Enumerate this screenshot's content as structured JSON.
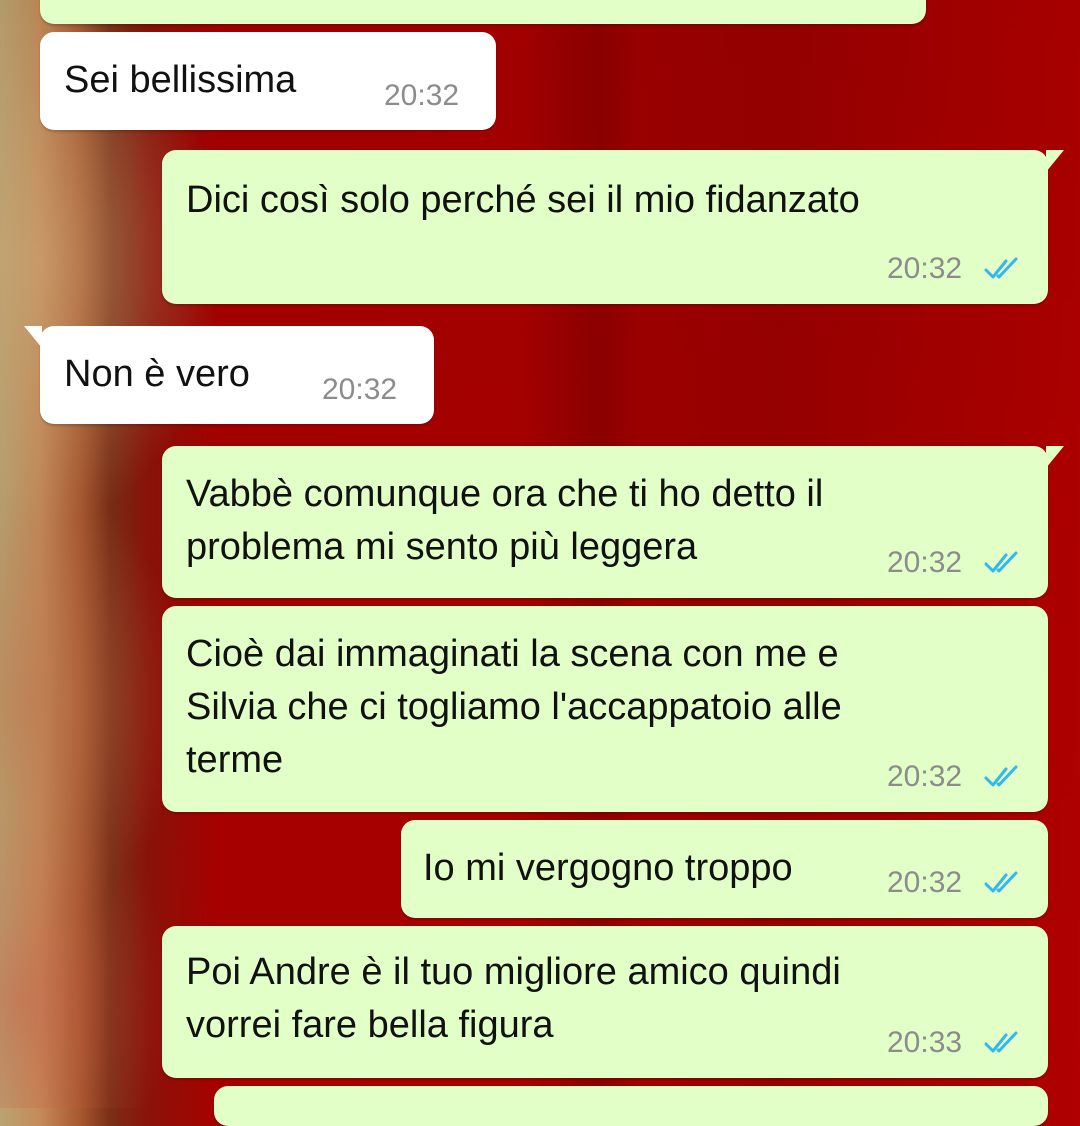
{
  "chat": {
    "messages": [
      {
        "id": "m0",
        "direction": "outgoing",
        "text": "",
        "time": "",
        "status": "read"
      },
      {
        "id": "m1",
        "direction": "incoming",
        "text": "Sei bellissima",
        "time": "20:32"
      },
      {
        "id": "m2",
        "direction": "outgoing",
        "text": "Dici così solo perché sei il mio fidanzato",
        "time": "20:32",
        "status": "read"
      },
      {
        "id": "m3",
        "direction": "incoming",
        "text": "Non è vero",
        "time": "20:32"
      },
      {
        "id": "m4",
        "direction": "outgoing",
        "text": "Vabbè comunque ora che ti ho detto il\nproblema mi sento più leggera",
        "time": "20:32",
        "status": "read"
      },
      {
        "id": "m5",
        "direction": "outgoing",
        "text": "Cioè dai immaginati la scena con me e\nSilvia che ci togliamo l'accappatoio alle\nterme",
        "time": "20:32",
        "status": "read"
      },
      {
        "id": "m6",
        "direction": "outgoing",
        "text": "Io mi vergogno troppo",
        "time": "20:32",
        "status": "read"
      },
      {
        "id": "m7",
        "direction": "outgoing",
        "text": "Poi Andre è il tuo migliore amico quindi\nvorrei fare bella figura",
        "time": "20:33",
        "status": "read"
      },
      {
        "id": "m8",
        "direction": "outgoing",
        "text": "",
        "time": "",
        "status": ""
      }
    ]
  },
  "icons": {
    "read_receipt": "double-check-icon"
  },
  "colors": {
    "incoming_bubble": "#ffffff",
    "outgoing_bubble": "#e1ffc7",
    "read_tick": "#34b7f1",
    "timestamp": "#8c8c8c"
  }
}
